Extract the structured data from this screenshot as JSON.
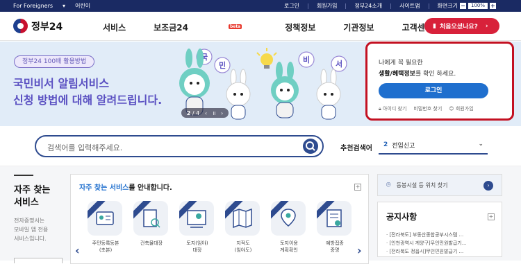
{
  "topbar": {
    "for_foreigners": "For Foreigners",
    "kids": "어린이",
    "login": "로그인",
    "signup": "회원가입",
    "intro": "정부24소개",
    "sitemap": "사이트맵",
    "zoom_label": "화면크기",
    "zoom_minus": "−",
    "zoom_value": "100%",
    "zoom_plus": "+"
  },
  "header": {
    "logo_text": "정부24",
    "menu": [
      "서비스",
      "보조금24",
      "정책정보",
      "기관정보",
      "고객센터"
    ],
    "beta": "beta",
    "cta": "처음오셨나요?"
  },
  "hero": {
    "pill": "정부24 100배 활용방법",
    "title_1": "국민비서 알림서비스",
    "title_2": "신청 방법에 대해 알려드립니다.",
    "bubbles": [
      "국",
      "민",
      "비",
      "서"
    ],
    "pager_current": "2",
    "pager_sep": "/",
    "pager_total": "4"
  },
  "login_panel": {
    "line1": "나에게 꼭 필요한",
    "line2_bold": "생활/혜택정보",
    "line2_rest": "를 확인 하세요.",
    "button": "로그인",
    "find_id": "아이디 찾기",
    "find_pw": "비밀번호 찾기",
    "join": "회원가입"
  },
  "search": {
    "placeholder": "검색어를 입력해주세요.",
    "rec_label": "추천검색어",
    "rec_rank": "2",
    "rec_term": "전입신고"
  },
  "favorites": {
    "title_1": "자주 찾는",
    "title_2": "서비스",
    "desc_1": "전자증명서는",
    "desc_2": "모바일 앱 전용",
    "desc_3": "서비스입니다."
  },
  "services": {
    "head_em": "자주 찾는 서비스",
    "head_rest": "를 안내합니다.",
    "tiles": [
      {
        "l1": "주민등록등본",
        "l2": "(초본)",
        "icon": "id-card-icon"
      },
      {
        "l1": "건축물대장",
        "l2": "",
        "icon": "document-search-icon"
      },
      {
        "l1": "토지(임야)",
        "l2": "대장",
        "icon": "land-map-icon"
      },
      {
        "l1": "지적도",
        "l2": "(임야도)",
        "icon": "folded-map-icon"
      },
      {
        "l1": "토지이용",
        "l2": "계획확인",
        "icon": "location-pin-icon"
      },
      {
        "l1": "예방접종",
        "l2": "증명",
        "icon": "vaccine-cert-icon"
      }
    ]
  },
  "right": {
    "location": "동봉시설 등 위치 찾기",
    "notice_title": "공지사항",
    "notices": [
      "[전라북도] 부동산종합공부시스템 ...",
      "[인천광역시 계양구]무인민원발급기...",
      "[전라북도 정읍시]무인민원발급기 ..."
    ]
  },
  "colors": {
    "topbar": "#1a2a63",
    "accent_red": "#d8213a",
    "hero_bg": "#e1ecf8",
    "hero_text": "#5b51c2",
    "primary_blue": "#1f6fce",
    "highlight_border": "#c31021"
  }
}
